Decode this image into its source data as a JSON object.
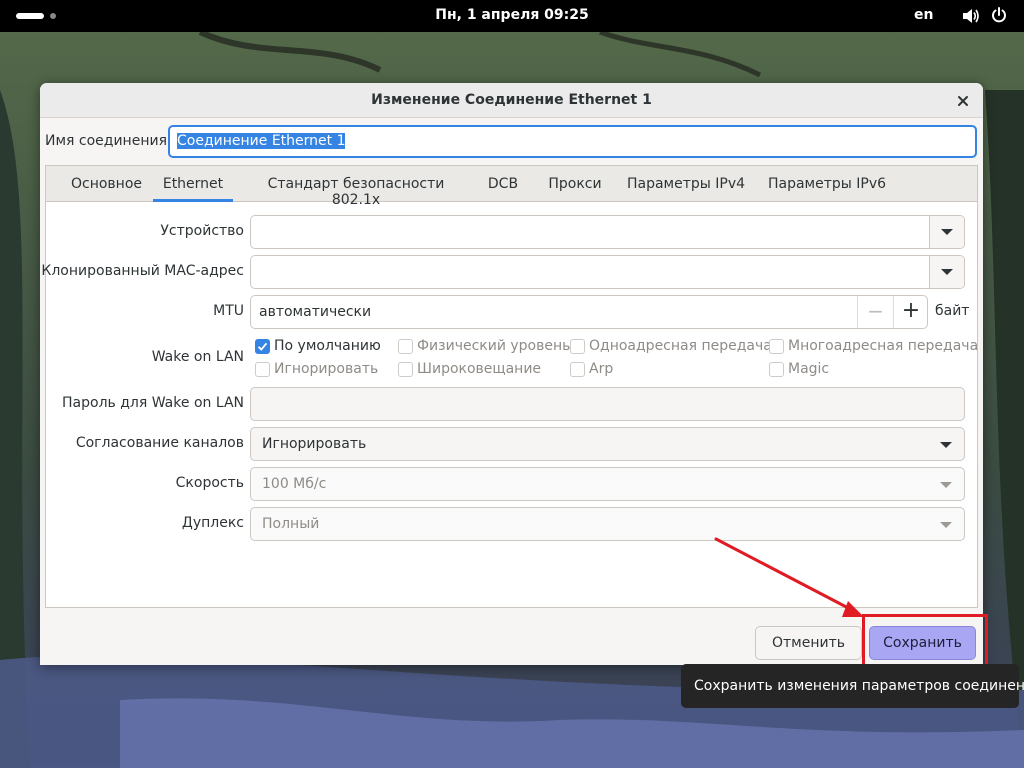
{
  "topbar": {
    "clock": "Пн, 1 апреля  09:25",
    "language": "en"
  },
  "dialog": {
    "title": "Изменение Соединение Ethernet 1",
    "connection_name_label": "Имя соединения",
    "connection_name_value": "Соединение Ethernet 1",
    "tabs": [
      {
        "label": "Основное"
      },
      {
        "label": "Ethernet"
      },
      {
        "label": "Стандарт безопасности 802.1x"
      },
      {
        "label": "DCB"
      },
      {
        "label": "Прокси"
      },
      {
        "label": "Параметры IPv4"
      },
      {
        "label": "Параметры IPv6"
      }
    ],
    "active_tab": "Ethernet",
    "ethernet": {
      "device_label": "Устройство",
      "device_value": "",
      "cloned_mac_label": "Клонированный MAC-адрес",
      "cloned_mac_value": "",
      "mtu_label": "MTU",
      "mtu_value": "автоматически",
      "mtu_unit": "байт",
      "wol_label": "Wake on LAN",
      "wol_options": [
        {
          "label": "По умолчанию",
          "checked": true,
          "enabled": true
        },
        {
          "label": "Физический уровень",
          "checked": false,
          "enabled": false
        },
        {
          "label": "Одноадресная передача",
          "checked": false,
          "enabled": false
        },
        {
          "label": "Многоадресная передача",
          "checked": false,
          "enabled": false
        },
        {
          "label": "Игнорировать",
          "checked": false,
          "enabled": false
        },
        {
          "label": "Широковещание",
          "checked": false,
          "enabled": false
        },
        {
          "label": "Arp",
          "checked": false,
          "enabled": false
        },
        {
          "label": "Magic",
          "checked": false,
          "enabled": false
        }
      ],
      "wol_password_label": "Пароль для Wake on LAN",
      "wol_password_value": "",
      "link_negotiation_label": "Согласование каналов",
      "link_negotiation_value": "Игнорировать",
      "speed_label": "Скорость",
      "speed_value": "100 Мб/с",
      "duplex_label": "Дуплекс",
      "duplex_value": "Полный"
    },
    "cancel_label": "Отменить",
    "save_label": "Сохранить"
  },
  "tooltip": "Сохранить изменения параметров соединения.",
  "colors": {
    "accent": "#3584e4",
    "save_button": "#a9a7f3",
    "annotation": "#e01b24"
  }
}
